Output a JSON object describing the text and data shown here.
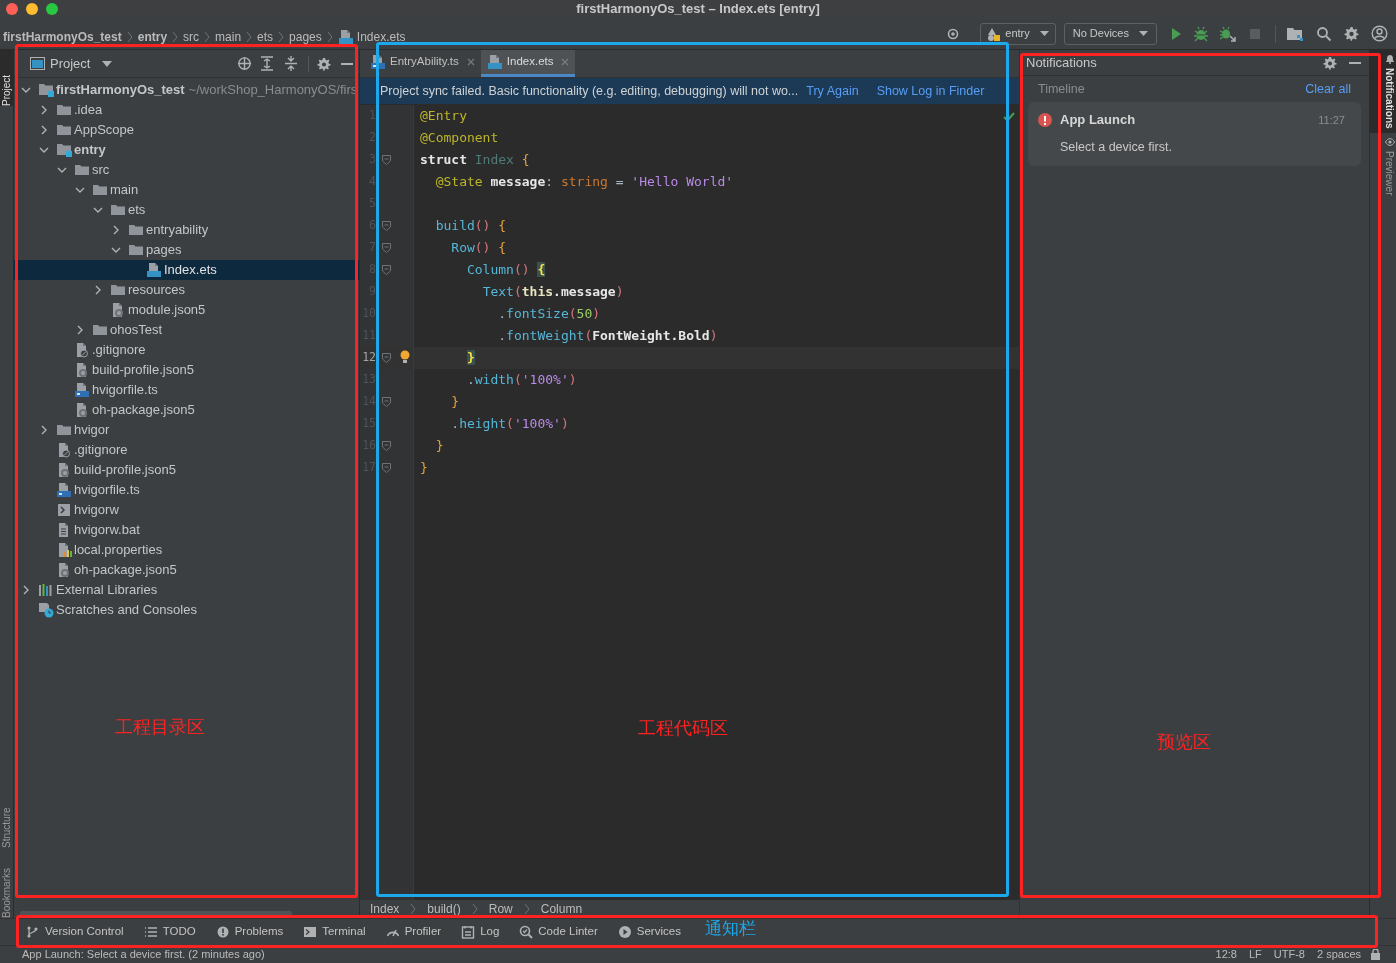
{
  "window": {
    "title": "firstHarmonyOs_test – Index.ets [entry]"
  },
  "nav_bar": {
    "breadcrumbs": [
      {
        "label": "firstHarmonyOs_test",
        "bold": true,
        "kind": "plain"
      },
      {
        "label": "entry",
        "bold": true,
        "kind": "plain"
      },
      {
        "label": "src",
        "bold": false,
        "kind": "plain"
      },
      {
        "label": "main",
        "bold": false,
        "kind": "plain"
      },
      {
        "label": "ets",
        "bold": false,
        "kind": "plain"
      },
      {
        "label": "pages",
        "bold": false,
        "kind": "plain"
      },
      {
        "label": "Index.ets",
        "bold": false,
        "kind": "ets"
      }
    ],
    "module_selector": "entry",
    "device_selector": "No Devices"
  },
  "left_strip": [
    {
      "label": "Project",
      "selected": true
    },
    {
      "label": "Structure",
      "selected": false
    },
    {
      "label": "Bookmarks",
      "selected": false
    }
  ],
  "project_panel": {
    "title": "Project",
    "tree": [
      {
        "label": "firstHarmonyOs_test",
        "path": "~/workShop_HarmonyOS/firs",
        "kind": "module",
        "expanded": true,
        "selected": false,
        "children": [
          {
            "label": ".idea",
            "kind": "folder",
            "expanded": false,
            "selected": false
          },
          {
            "label": "AppScope",
            "kind": "folder",
            "expanded": false,
            "selected": false
          },
          {
            "label": "entry",
            "kind": "module",
            "expanded": true,
            "selected": false,
            "children": [
              {
                "label": "src",
                "kind": "folder",
                "expanded": true,
                "selected": false,
                "children": [
                  {
                    "label": "main",
                    "kind": "folder",
                    "expanded": true,
                    "selected": false,
                    "children": [
                      {
                        "label": "ets",
                        "kind": "folder",
                        "expanded": true,
                        "selected": false,
                        "children": [
                          {
                            "label": "entryability",
                            "kind": "folder",
                            "expanded": false,
                            "selected": false
                          },
                          {
                            "label": "pages",
                            "kind": "folder",
                            "expanded": true,
                            "selected": false,
                            "children": [
                              {
                                "label": "Index.ets",
                                "kind": "ets",
                                "selected": true
                              }
                            ]
                          }
                        ]
                      },
                      {
                        "label": "resources",
                        "kind": "folder",
                        "expanded": false,
                        "selected": false
                      },
                      {
                        "label": "module.json5",
                        "kind": "json",
                        "selected": false
                      }
                    ]
                  },
                  {
                    "label": "ohosTest",
                    "kind": "folder",
                    "expanded": false,
                    "selected": false
                  }
                ]
              },
              {
                "label": ".gitignore",
                "kind": "ignore",
                "selected": false
              },
              {
                "label": "build-profile.json5",
                "kind": "json",
                "selected": false
              },
              {
                "label": "hvigorfile.ts",
                "kind": "ts",
                "selected": false
              },
              {
                "label": "oh-package.json5",
                "kind": "json",
                "selected": false
              }
            ]
          },
          {
            "label": "hvigor",
            "kind": "folder",
            "expanded": false,
            "selected": false
          },
          {
            "label": ".gitignore",
            "kind": "ignore",
            "selected": false
          },
          {
            "label": "build-profile.json5",
            "kind": "json",
            "selected": false
          },
          {
            "label": "hvigorfile.ts",
            "kind": "ts",
            "selected": false
          },
          {
            "label": "hvigorw",
            "kind": "script",
            "selected": false
          },
          {
            "label": "hvigorw.bat",
            "kind": "bat",
            "selected": false
          },
          {
            "label": "local.properties",
            "kind": "props",
            "selected": false
          },
          {
            "label": "oh-package.json5",
            "kind": "json",
            "selected": false
          }
        ]
      },
      {
        "label": "External Libraries",
        "kind": "libs",
        "expanded": false,
        "selected": false
      },
      {
        "label": "Scratches and Consoles",
        "kind": "scratch",
        "selected": false
      }
    ]
  },
  "editor": {
    "tabs": [
      {
        "label": "EntryAbility.ts",
        "kind": "ts",
        "selected": false
      },
      {
        "label": "Index.ets",
        "kind": "ets",
        "selected": true
      }
    ],
    "banner": {
      "message": "Project sync failed. Basic functionality (e.g. editing, debugging) will not wo...",
      "links": [
        "Try Again",
        "Show Log in Finder"
      ]
    },
    "lines": [
      {
        "number": "1",
        "current": false,
        "fold": false,
        "tokens": [
          {
            "kind": "annotation",
            "t": "@Entry"
          }
        ]
      },
      {
        "number": "2",
        "current": false,
        "fold": false,
        "tokens": [
          {
            "kind": "annotation",
            "t": "@Component"
          }
        ]
      },
      {
        "number": "3",
        "current": false,
        "fold": true,
        "tokens": [
          {
            "kind": "keyword",
            "t": "struct"
          },
          {
            "kind": "type",
            "t": " Index"
          },
          {
            "kind": "brace",
            "t": " {"
          }
        ]
      },
      {
        "number": "4",
        "current": false,
        "fold": false,
        "tokens": [
          {
            "kind": "annotation",
            "t": "  @State"
          },
          {
            "kind": "field",
            "t": " message"
          },
          {
            "kind": "plain",
            "t": ": "
          },
          {
            "kind": "typekw",
            "t": "string"
          },
          {
            "kind": "plain",
            "t": " = "
          },
          {
            "kind": "string",
            "t": "'Hello World'"
          }
        ]
      },
      {
        "number": "5",
        "current": false,
        "fold": false
      },
      {
        "number": "6",
        "current": false,
        "fold": true,
        "tokens": [
          {
            "kind": "fn",
            "t": "  build"
          },
          {
            "kind": "paren",
            "t": "()"
          },
          {
            "kind": "brace",
            "t": " {"
          }
        ]
      },
      {
        "number": "7",
        "current": false,
        "fold": true,
        "tokens": [
          {
            "kind": "fn",
            "t": "    Row"
          },
          {
            "kind": "paren",
            "t": "()"
          },
          {
            "kind": "brace",
            "t": " {"
          }
        ]
      },
      {
        "number": "8",
        "current": false,
        "fold": true,
        "tokens": [
          {
            "kind": "fn",
            "t": "      Column"
          },
          {
            "kind": "paren",
            "t": "() "
          },
          {
            "kind": "match",
            "t": "{"
          }
        ]
      },
      {
        "number": "9",
        "current": false,
        "fold": false,
        "tokens": [
          {
            "kind": "fn",
            "t": "        Text"
          },
          {
            "kind": "paren",
            "t": "("
          },
          {
            "kind": "this",
            "t": "this"
          },
          {
            "kind": "field",
            "t": ".message"
          },
          {
            "kind": "paren",
            "t": ")"
          }
        ]
      },
      {
        "number": "10",
        "current": false,
        "fold": false,
        "tokens": [
          {
            "kind": "plain",
            "t": "          ."
          },
          {
            "kind": "fn",
            "t": "fontSize"
          },
          {
            "kind": "paren",
            "t": "("
          },
          {
            "kind": "number",
            "t": "50"
          },
          {
            "kind": "paren",
            "t": ")"
          }
        ]
      },
      {
        "number": "11",
        "current": false,
        "fold": false,
        "tokens": [
          {
            "kind": "plain",
            "t": "          ."
          },
          {
            "kind": "fn",
            "t": "fontWeight"
          },
          {
            "kind": "paren",
            "t": "("
          },
          {
            "kind": "field",
            "t": "FontWeight.Bold"
          },
          {
            "kind": "paren",
            "t": ")"
          }
        ]
      },
      {
        "number": "12",
        "current": true,
        "fold": true,
        "bulb": true,
        "tokens": [
          {
            "kind": "match",
            "t": "      }"
          }
        ]
      },
      {
        "number": "13",
        "current": false,
        "fold": false,
        "tokens": [
          {
            "kind": "plain",
            "t": "      ."
          },
          {
            "kind": "fn",
            "t": "width"
          },
          {
            "kind": "paren",
            "t": "("
          },
          {
            "kind": "string",
            "t": "'100%'"
          },
          {
            "kind": "paren",
            "t": ")"
          }
        ]
      },
      {
        "number": "14",
        "current": false,
        "fold": true,
        "tokens": [
          {
            "kind": "brace",
            "t": "    }"
          }
        ]
      },
      {
        "number": "15",
        "current": false,
        "fold": false,
        "tokens": [
          {
            "kind": "plain",
            "t": "    ."
          },
          {
            "kind": "fn",
            "t": "height"
          },
          {
            "kind": "paren",
            "t": "("
          },
          {
            "kind": "string",
            "t": "'100%'"
          },
          {
            "kind": "paren",
            "t": ")"
          }
        ]
      },
      {
        "number": "16",
        "current": false,
        "fold": true,
        "tokens": [
          {
            "kind": "brace",
            "t": "  }"
          }
        ]
      },
      {
        "number": "17",
        "current": false,
        "fold": true,
        "tokens": [
          {
            "kind": "brace",
            "t": "}"
          }
        ]
      }
    ],
    "breadcrumbs": [
      "Index",
      "build()",
      "Row",
      "Column"
    ]
  },
  "notifications": {
    "title": "Notifications",
    "section": "Timeline",
    "clear": "Clear all",
    "items": [
      {
        "title": "App Launch",
        "time": "11:27",
        "message": "Select a device first.",
        "kind": "error"
      }
    ]
  },
  "right_strip": [
    {
      "label": "Notifications",
      "selected": true,
      "kind": "bell"
    },
    {
      "label": "Previewer",
      "selected": false,
      "kind": "eye"
    }
  ],
  "tool_tabs": [
    {
      "label": "Version Control",
      "kind": "vcs"
    },
    {
      "label": "TODO",
      "kind": "todo"
    },
    {
      "label": "Problems",
      "kind": "problems"
    },
    {
      "label": "Terminal",
      "kind": "terminal"
    },
    {
      "label": "Profiler",
      "kind": "profiler"
    },
    {
      "label": "Log",
      "kind": "log"
    },
    {
      "label": "Code Linter",
      "kind": "linter"
    },
    {
      "label": "Services",
      "kind": "services"
    }
  ],
  "status_bar": {
    "message": "App Launch: Select a device first. (2 minutes ago)",
    "items": [
      "12:8",
      "LF",
      "UTF-8",
      "2 spaces"
    ]
  },
  "annotation_frames": [
    {
      "color": "#ff2222"
    },
    {
      "color": "#1ca8ea"
    },
    {
      "color": "#ff2222"
    },
    {
      "color": "#ff2222"
    }
  ],
  "annotation_labels": [
    {
      "label": "工程目录区",
      "color": "#ff2222"
    },
    {
      "label": "工程代码区",
      "color": "#ff2222"
    },
    {
      "label": "预览区",
      "color": "#ff2222"
    },
    {
      "label": "通知栏",
      "color": "#1ca8ea"
    }
  ]
}
